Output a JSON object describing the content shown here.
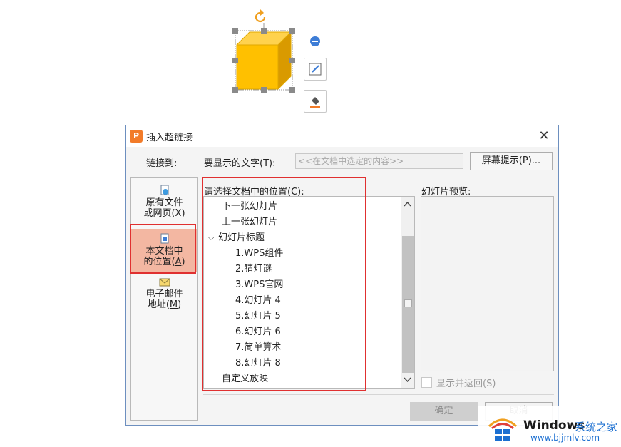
{
  "dialog": {
    "title": "插入超链接",
    "close_glyph": "✕",
    "link_to_label": "链接到:",
    "display_text_label": "要显示的文字(T):",
    "display_text_value": "<<在文档中选定的内容>>",
    "screentip_button": "屏幕提示(P)...",
    "nav": [
      {
        "line1": "原有文件",
        "line2_pre": "或网页(",
        "key": "X",
        "line2_post": ")",
        "icon": "file-web-icon"
      },
      {
        "line1": "本文档中",
        "line2_pre": "的位置(",
        "key": "A",
        "line2_post": ")",
        "icon": "document-place-icon",
        "selected": true
      },
      {
        "line1": "电子邮件",
        "line2_pre": "地址(",
        "key": "M",
        "line2_post": ")",
        "icon": "email-icon"
      }
    ],
    "place_label": "请选择文档中的位置(C):",
    "places": {
      "next_slide": "下一张幻灯片",
      "prev_slide": "上一张幻灯片",
      "slide_titles": "幻灯片标题",
      "slides": [
        "1.WPS组件",
        "2.猜灯谜",
        "3.WPS官网",
        "4.幻灯片 4",
        "5.幻灯片 5",
        "6.幻灯片 6",
        "7.简单算术",
        "8.幻灯片 8"
      ],
      "custom_show": "自定义放映"
    },
    "preview_label": "幻灯片预览:",
    "show_and_return": "显示并返回(S)",
    "ok_button": "确定",
    "cancel_button": "取消"
  },
  "watermark": {
    "brand": "Windows",
    "brand_cn": "系统之家",
    "url": "www.bjjmlv.com"
  },
  "colors": {
    "shape_fill": "#ffc000",
    "highlight_red": "#e03030",
    "selected_nav_bg": "#f3b7a2",
    "accent_orange": "#f27b29"
  }
}
